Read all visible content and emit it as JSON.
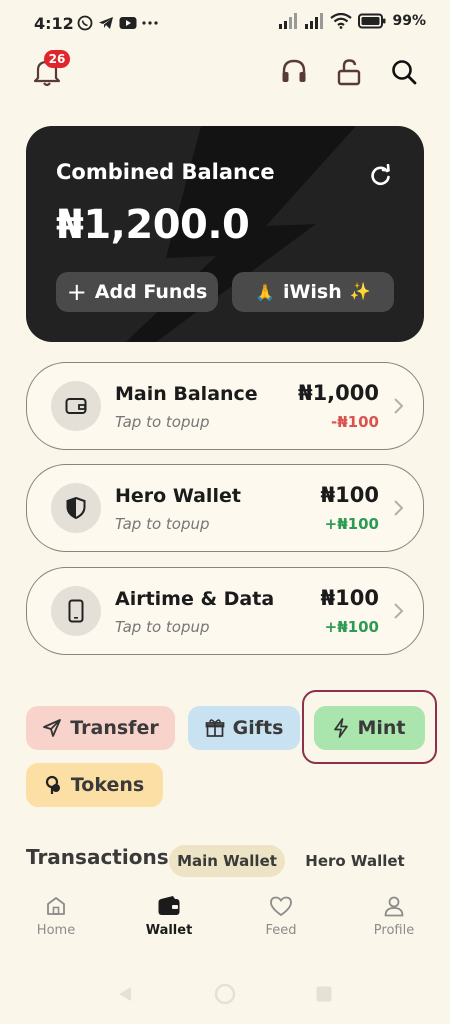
{
  "status_bar": {
    "time": "4:12",
    "battery": "99%",
    "app_icons": [
      "whatsapp-icon",
      "telegram-icon",
      "youtube-icon",
      "more-dots-icon"
    ]
  },
  "header": {
    "notification_count": "26",
    "icons": [
      "bell-icon",
      "headset-icon",
      "unlock-icon",
      "search-icon"
    ]
  },
  "balance_card": {
    "title": "Combined Balance",
    "amount": "₦1,200.0",
    "add_funds_label": "Add Funds",
    "add_funds_icon": "+",
    "iwish_label": "iWish",
    "iwish_prefix": "🙏",
    "iwish_suffix": "✨"
  },
  "wallets": [
    {
      "title": "Main Balance",
      "subtitle": "Tap to topup",
      "amount": "₦1,000",
      "change": "-₦100",
      "change_color": "#D9534F",
      "icon": "wallet-icon"
    },
    {
      "title": "Hero Wallet",
      "subtitle": "Tap to topup",
      "amount": "₦100",
      "change": "+₦100",
      "change_color": "#2E9B55",
      "icon": "shield-icon"
    },
    {
      "title": "Airtime & Data",
      "subtitle": "Tap to topup",
      "amount": "₦100",
      "change": "+₦100",
      "change_color": "#2E9B55",
      "icon": "phone-icon"
    }
  ],
  "actions": [
    {
      "label": "Transfer",
      "icon": "send-icon",
      "bg": "#F8D3CC"
    },
    {
      "label": "Gifts",
      "icon": "gift-icon",
      "bg": "#C8E2F2"
    },
    {
      "label": "Mint",
      "icon": "bolt-icon",
      "bg": "#A9E5AD"
    },
    {
      "label": "Tokens",
      "icon": "coins-icon",
      "bg": "#FBDFA5"
    }
  ],
  "transactions": {
    "title": "Transactions",
    "tabs": [
      "Main Wallet",
      "Hero Wallet"
    ],
    "active_tab": "Main Wallet"
  },
  "bottom_nav": {
    "items": [
      "Home",
      "Wallet",
      "Feed",
      "Profile"
    ],
    "active": "Wallet"
  },
  "colors": {
    "background": "#FBF6EA",
    "card": "#222222",
    "badge": "#E0262B"
  }
}
